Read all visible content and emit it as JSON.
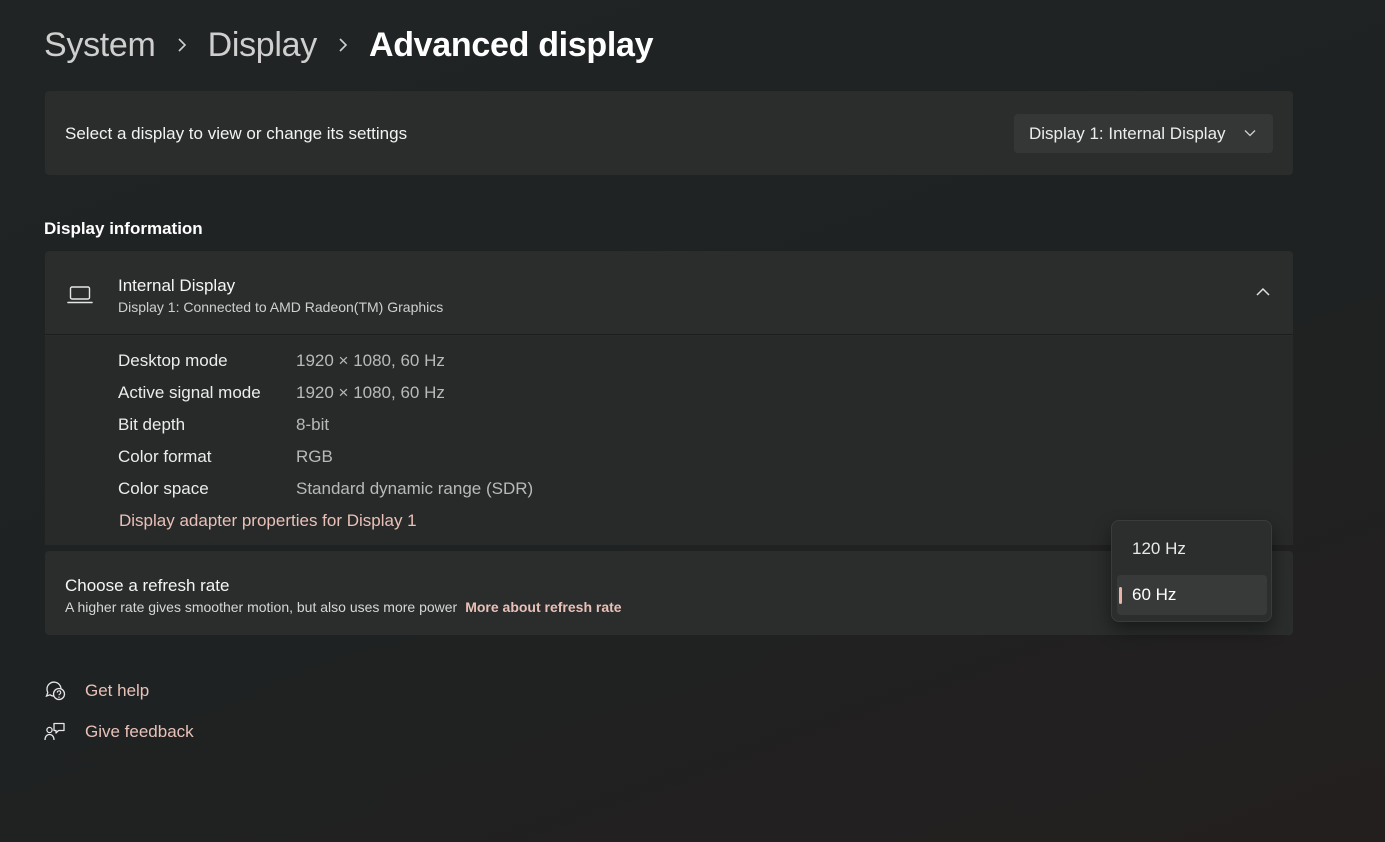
{
  "breadcrumb": {
    "items": [
      "System",
      "Display"
    ],
    "current": "Advanced display"
  },
  "display_select": {
    "label": "Select a display to view or change its settings",
    "value": "Display 1: Internal Display"
  },
  "section_title": "Display information",
  "display_info": {
    "name": "Internal Display",
    "subtitle": "Display 1: Connected to AMD Radeon(TM) Graphics",
    "rows": [
      {
        "key": "Desktop mode",
        "value": "1920 × 1080, 60 Hz"
      },
      {
        "key": "Active signal mode",
        "value": "1920 × 1080, 60 Hz"
      },
      {
        "key": "Bit depth",
        "value": "8-bit"
      },
      {
        "key": "Color format",
        "value": "RGB"
      },
      {
        "key": "Color space",
        "value": "Standard dynamic range (SDR)"
      }
    ],
    "adapter_link": "Display adapter properties for Display 1"
  },
  "refresh": {
    "title": "Choose a refresh rate",
    "subtitle": "A higher rate gives smoother motion, but also uses more power",
    "more_link": "More about refresh rate",
    "options": [
      "120 Hz",
      "60 Hz"
    ],
    "selected": "60 Hz"
  },
  "help": {
    "get_help": "Get help",
    "feedback": "Give feedback"
  },
  "colors": {
    "accent": "#e9c1b8",
    "card": "#2b2d2d",
    "background": "#202424"
  }
}
